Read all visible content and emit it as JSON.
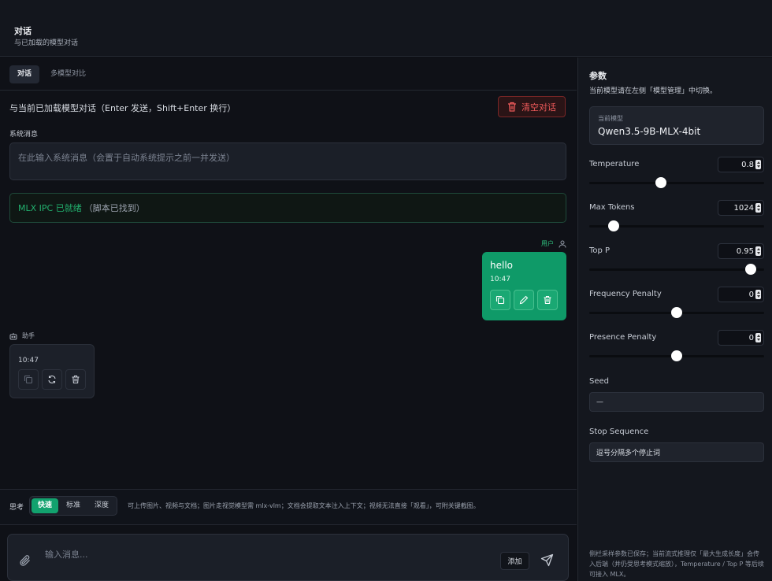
{
  "header": {
    "title": "对话",
    "subtitle": "与已加载的模型对话"
  },
  "tabs": [
    {
      "label": "对话",
      "active": true
    },
    {
      "label": "多模型对比",
      "active": false
    }
  ],
  "chat": {
    "description": "与当前已加载模型对话（Enter 发送，Shift+Enter 换行）",
    "clear_label": "清空对话",
    "system_label": "系统消息",
    "system_placeholder": "在此输入系统消息（会置于自动系统提示之前一并发送）",
    "status_ok": "MLX IPC 已就绪",
    "status_note": "（脚本已找到）",
    "messages": [
      {
        "role_label": "用户",
        "text": "hello",
        "time": "10:47"
      },
      {
        "role_label": "助手",
        "text": "",
        "time": "10:47"
      }
    ]
  },
  "thinking": {
    "label": "思考",
    "options": [
      {
        "label": "快速",
        "active": true
      },
      {
        "label": "标准",
        "active": false
      },
      {
        "label": "深度",
        "active": false
      }
    ],
    "hint": "可上传图片、视频与文档；图片走视觉模型需 mlx-vlm；文档会提取文本注入上下文；视频无法直接「观看」，可附关键截图。"
  },
  "composer": {
    "placeholder": "输入消息...",
    "add_label": "添加"
  },
  "params": {
    "title": "参数",
    "subtitle": "当前模型请在左侧「模型管理」中切换。",
    "current_model_label": "当前模型",
    "current_model": "Qwen3.5-9B-MLX-4bit",
    "sliders": [
      {
        "name": "Temperature",
        "value": "0.8",
        "fraction": 0.41
      },
      {
        "name": "Max Tokens",
        "value": "1024",
        "fraction": 0.14
      },
      {
        "name": "Top P",
        "value": "0.95",
        "fraction": 0.925
      },
      {
        "name": "Frequency Penalty",
        "value": "0",
        "fraction": 0.5
      },
      {
        "name": "Presence Penalty",
        "value": "0",
        "fraction": 0.5
      }
    ],
    "seed_label": "Seed",
    "seed_value": "—",
    "stop_label": "Stop Sequence",
    "stop_placeholder": "逗号分隔多个停止词",
    "footer": "侧栏采样参数已保存；当前流式推理仅「最大生成长度」会传入后端（并仍受思考模式缩放），Temperature / Top P 等后续可接入 MLX。"
  }
}
